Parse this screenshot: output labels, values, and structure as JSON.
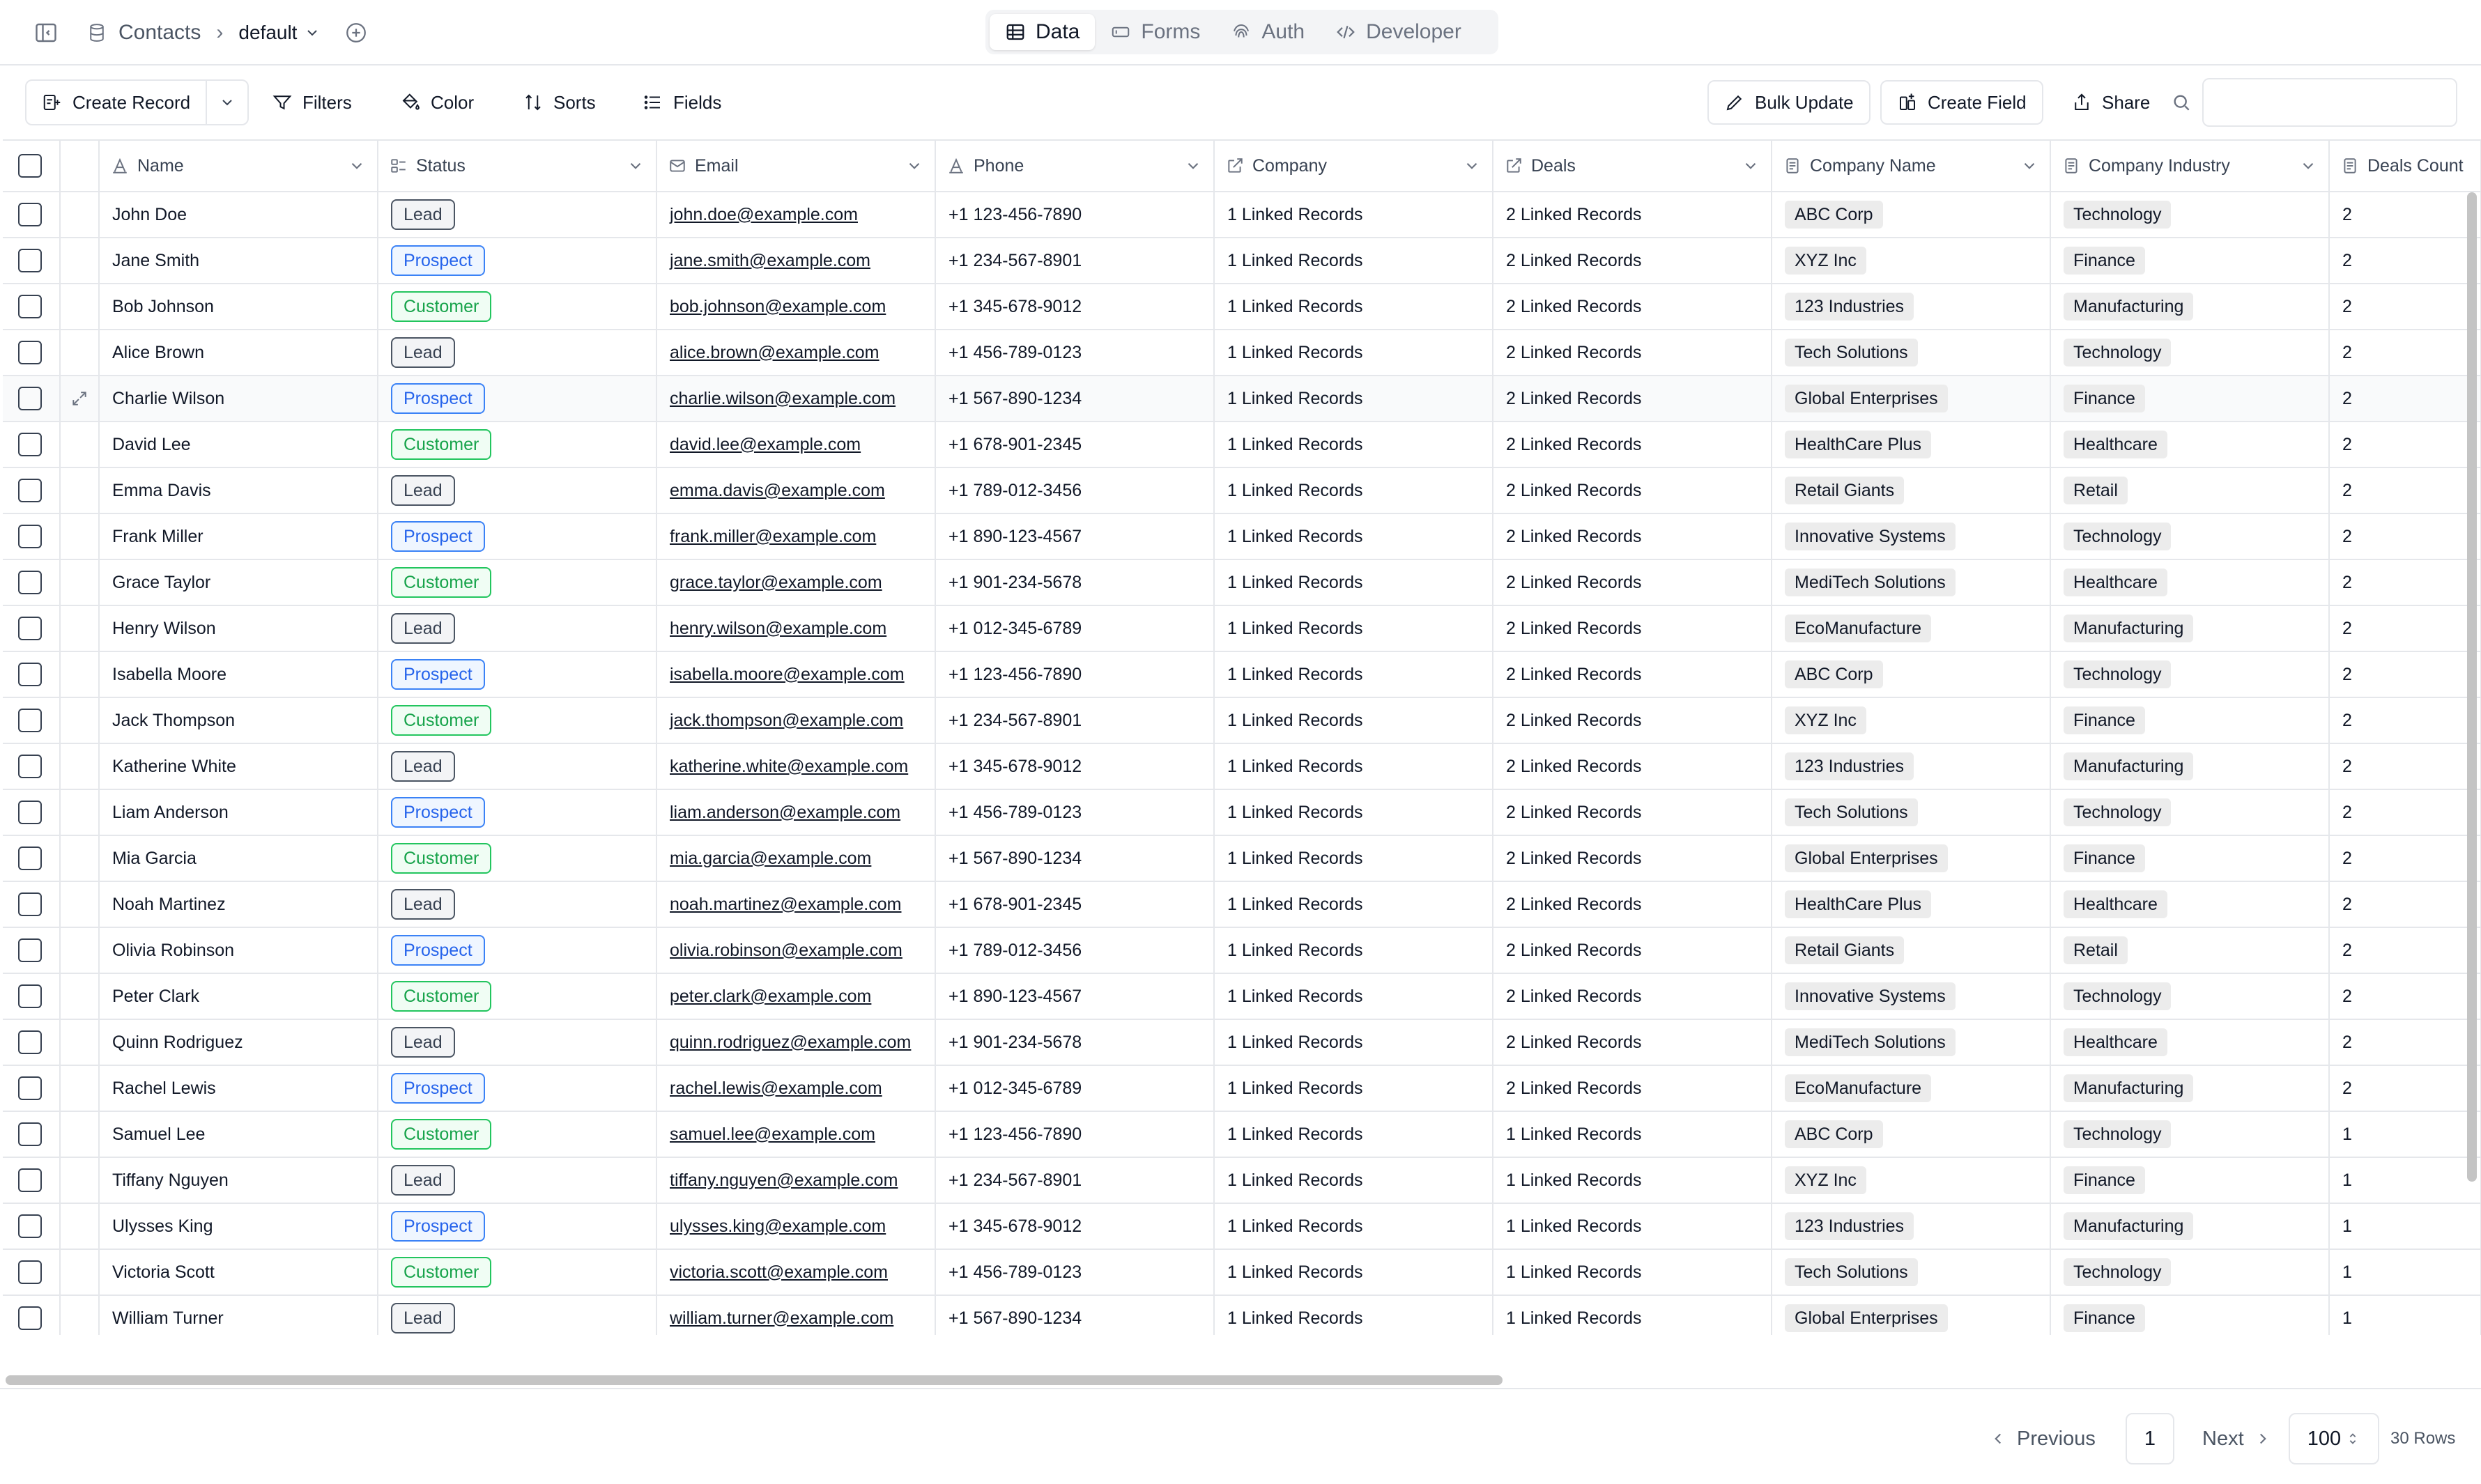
{
  "header": {
    "breadcrumb_table": "Contacts",
    "breadcrumb_view": "default",
    "tabs": [
      {
        "label": "Data",
        "icon": "table-icon",
        "active": true
      },
      {
        "label": "Forms",
        "icon": "form-icon",
        "active": false
      },
      {
        "label": "Auth",
        "icon": "fingerprint-icon",
        "active": false
      },
      {
        "label": "Developer",
        "icon": "code-icon",
        "active": false
      }
    ]
  },
  "toolbar": {
    "create_record": "Create Record",
    "filters": "Filters",
    "color": "Color",
    "sorts": "Sorts",
    "fields": "Fields",
    "bulk_update": "Bulk Update",
    "create_field": "Create Field",
    "share": "Share",
    "search_value": ""
  },
  "columns": [
    {
      "label": "Name",
      "icon": "text-icon"
    },
    {
      "label": "Status",
      "icon": "select-icon"
    },
    {
      "label": "Email",
      "icon": "mail-icon"
    },
    {
      "label": "Phone",
      "icon": "text-icon"
    },
    {
      "label": "Company",
      "icon": "link-icon"
    },
    {
      "label": "Deals",
      "icon": "link-icon"
    },
    {
      "label": "Company Name",
      "icon": "lookup-icon"
    },
    {
      "label": "Company Industry",
      "icon": "lookup-icon"
    },
    {
      "label": "Deals Count",
      "icon": "lookup-icon"
    }
  ],
  "status_colors": {
    "Lead": "#4b5563",
    "Prospect": "#3b82f6",
    "Customer": "#22c55e"
  },
  "rows": [
    {
      "name": "John Doe",
      "status": "Lead",
      "email": "john.doe@example.com",
      "phone": "+1 123-456-7890",
      "company": "1 Linked Records",
      "deals": "2 Linked Records",
      "company_name": "ABC Corp",
      "industry": "Technology",
      "deals_count": "2"
    },
    {
      "name": "Jane Smith",
      "status": "Prospect",
      "email": "jane.smith@example.com",
      "phone": "+1 234-567-8901",
      "company": "1 Linked Records",
      "deals": "2 Linked Records",
      "company_name": "XYZ Inc",
      "industry": "Finance",
      "deals_count": "2"
    },
    {
      "name": "Bob Johnson",
      "status": "Customer",
      "email": "bob.johnson@example.com",
      "phone": "+1 345-678-9012",
      "company": "1 Linked Records",
      "deals": "2 Linked Records",
      "company_name": "123 Industries",
      "industry": "Manufacturing",
      "deals_count": "2"
    },
    {
      "name": "Alice Brown",
      "status": "Lead",
      "email": "alice.brown@example.com",
      "phone": "+1 456-789-0123",
      "company": "1 Linked Records",
      "deals": "2 Linked Records",
      "company_name": "Tech Solutions",
      "industry": "Technology",
      "deals_count": "2"
    },
    {
      "name": "Charlie Wilson",
      "status": "Prospect",
      "email": "charlie.wilson@example.com",
      "phone": "+1 567-890-1234",
      "company": "1 Linked Records",
      "deals": "2 Linked Records",
      "company_name": "Global Enterprises",
      "industry": "Finance",
      "deals_count": "2"
    },
    {
      "name": "David Lee",
      "status": "Customer",
      "email": "david.lee@example.com",
      "phone": "+1 678-901-2345",
      "company": "1 Linked Records",
      "deals": "2 Linked Records",
      "company_name": "HealthCare Plus",
      "industry": "Healthcare",
      "deals_count": "2"
    },
    {
      "name": "Emma Davis",
      "status": "Lead",
      "email": "emma.davis@example.com",
      "phone": "+1 789-012-3456",
      "company": "1 Linked Records",
      "deals": "2 Linked Records",
      "company_name": "Retail Giants",
      "industry": "Retail",
      "deals_count": "2"
    },
    {
      "name": "Frank Miller",
      "status": "Prospect",
      "email": "frank.miller@example.com",
      "phone": "+1 890-123-4567",
      "company": "1 Linked Records",
      "deals": "2 Linked Records",
      "company_name": "Innovative Systems",
      "industry": "Technology",
      "deals_count": "2"
    },
    {
      "name": "Grace Taylor",
      "status": "Customer",
      "email": "grace.taylor@example.com",
      "phone": "+1 901-234-5678",
      "company": "1 Linked Records",
      "deals": "2 Linked Records",
      "company_name": "MediTech Solutions",
      "industry": "Healthcare",
      "deals_count": "2"
    },
    {
      "name": "Henry Wilson",
      "status": "Lead",
      "email": "henry.wilson@example.com",
      "phone": "+1 012-345-6789",
      "company": "1 Linked Records",
      "deals": "2 Linked Records",
      "company_name": "EcoManufacture",
      "industry": "Manufacturing",
      "deals_count": "2"
    },
    {
      "name": "Isabella Moore",
      "status": "Prospect",
      "email": "isabella.moore@example.com",
      "phone": "+1 123-456-7890",
      "company": "1 Linked Records",
      "deals": "2 Linked Records",
      "company_name": "ABC Corp",
      "industry": "Technology",
      "deals_count": "2"
    },
    {
      "name": "Jack Thompson",
      "status": "Customer",
      "email": "jack.thompson@example.com",
      "phone": "+1 234-567-8901",
      "company": "1 Linked Records",
      "deals": "2 Linked Records",
      "company_name": "XYZ Inc",
      "industry": "Finance",
      "deals_count": "2"
    },
    {
      "name": "Katherine White",
      "status": "Lead",
      "email": "katherine.white@example.com",
      "phone": "+1 345-678-9012",
      "company": "1 Linked Records",
      "deals": "2 Linked Records",
      "company_name": "123 Industries",
      "industry": "Manufacturing",
      "deals_count": "2"
    },
    {
      "name": "Liam Anderson",
      "status": "Prospect",
      "email": "liam.anderson@example.com",
      "phone": "+1 456-789-0123",
      "company": "1 Linked Records",
      "deals": "2 Linked Records",
      "company_name": "Tech Solutions",
      "industry": "Technology",
      "deals_count": "2"
    },
    {
      "name": "Mia Garcia",
      "status": "Customer",
      "email": "mia.garcia@example.com",
      "phone": "+1 567-890-1234",
      "company": "1 Linked Records",
      "deals": "2 Linked Records",
      "company_name": "Global Enterprises",
      "industry": "Finance",
      "deals_count": "2"
    },
    {
      "name": "Noah Martinez",
      "status": "Lead",
      "email": "noah.martinez@example.com",
      "phone": "+1 678-901-2345",
      "company": "1 Linked Records",
      "deals": "2 Linked Records",
      "company_name": "HealthCare Plus",
      "industry": "Healthcare",
      "deals_count": "2"
    },
    {
      "name": "Olivia Robinson",
      "status": "Prospect",
      "email": "olivia.robinson@example.com",
      "phone": "+1 789-012-3456",
      "company": "1 Linked Records",
      "deals": "2 Linked Records",
      "company_name": "Retail Giants",
      "industry": "Retail",
      "deals_count": "2"
    },
    {
      "name": "Peter Clark",
      "status": "Customer",
      "email": "peter.clark@example.com",
      "phone": "+1 890-123-4567",
      "company": "1 Linked Records",
      "deals": "2 Linked Records",
      "company_name": "Innovative Systems",
      "industry": "Technology",
      "deals_count": "2"
    },
    {
      "name": "Quinn Rodriguez",
      "status": "Lead",
      "email": "quinn.rodriguez@example.com",
      "phone": "+1 901-234-5678",
      "company": "1 Linked Records",
      "deals": "2 Linked Records",
      "company_name": "MediTech Solutions",
      "industry": "Healthcare",
      "deals_count": "2"
    },
    {
      "name": "Rachel Lewis",
      "status": "Prospect",
      "email": "rachel.lewis@example.com",
      "phone": "+1 012-345-6789",
      "company": "1 Linked Records",
      "deals": "2 Linked Records",
      "company_name": "EcoManufacture",
      "industry": "Manufacturing",
      "deals_count": "2"
    },
    {
      "name": "Samuel Lee",
      "status": "Customer",
      "email": "samuel.lee@example.com",
      "phone": "+1 123-456-7890",
      "company": "1 Linked Records",
      "deals": "1 Linked Records",
      "company_name": "ABC Corp",
      "industry": "Technology",
      "deals_count": "1"
    },
    {
      "name": "Tiffany Nguyen",
      "status": "Lead",
      "email": "tiffany.nguyen@example.com",
      "phone": "+1 234-567-8901",
      "company": "1 Linked Records",
      "deals": "1 Linked Records",
      "company_name": "XYZ Inc",
      "industry": "Finance",
      "deals_count": "1"
    },
    {
      "name": "Ulysses King",
      "status": "Prospect",
      "email": "ulysses.king@example.com",
      "phone": "+1 345-678-9012",
      "company": "1 Linked Records",
      "deals": "1 Linked Records",
      "company_name": "123 Industries",
      "industry": "Manufacturing",
      "deals_count": "1"
    },
    {
      "name": "Victoria Scott",
      "status": "Customer",
      "email": "victoria.scott@example.com",
      "phone": "+1 456-789-0123",
      "company": "1 Linked Records",
      "deals": "1 Linked Records",
      "company_name": "Tech Solutions",
      "industry": "Technology",
      "deals_count": "1"
    },
    {
      "name": "William Turner",
      "status": "Lead",
      "email": "william.turner@example.com",
      "phone": "+1 567-890-1234",
      "company": "1 Linked Records",
      "deals": "1 Linked Records",
      "company_name": "Global Enterprises",
      "industry": "Finance",
      "deals_count": "1"
    }
  ],
  "pagination": {
    "previous": "Previous",
    "page": "1",
    "next": "Next",
    "page_size": "100",
    "rows_count": "30 Rows"
  }
}
